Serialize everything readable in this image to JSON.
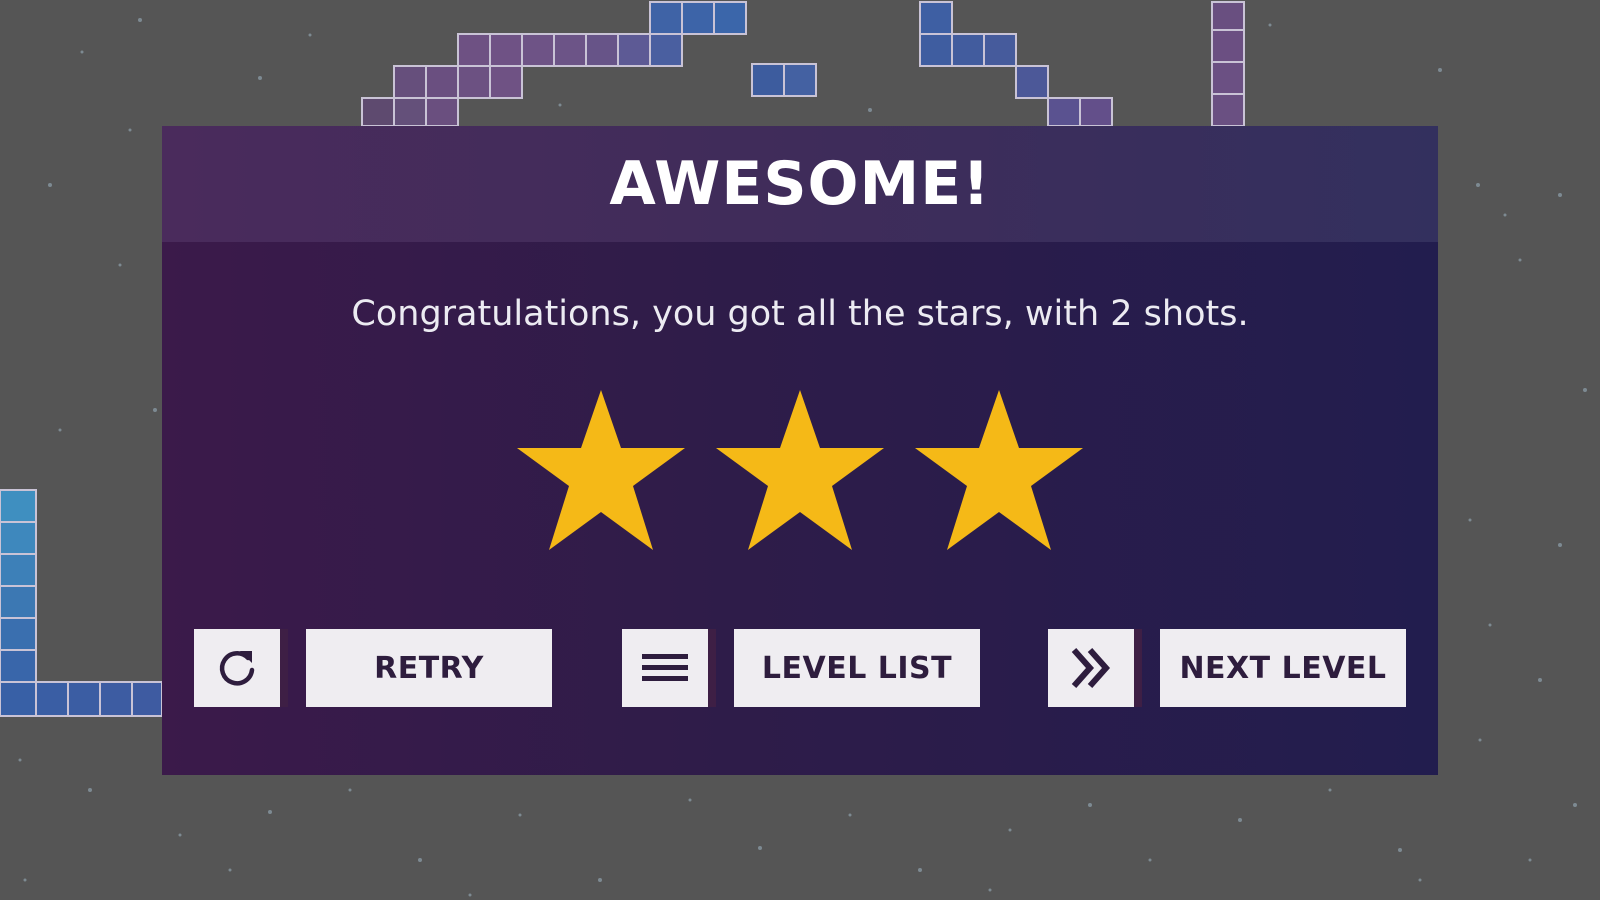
{
  "modal": {
    "title": "AWESOME!",
    "message": "Congratulations, you got all the stars, with 2 shots.",
    "stars_earned": 3,
    "stars_total": 3,
    "star_color": "#f5b917"
  },
  "buttons": {
    "retry": {
      "label": "RETRY",
      "icon": "retry-icon"
    },
    "level_list": {
      "label": "LEVEL LIST",
      "icon": "menu-icon"
    },
    "next_level": {
      "label": "NEXT LEVEL",
      "icon": "double-chevron-right-icon"
    }
  },
  "colors": {
    "background": "#555555",
    "button_bg": "#efedf1",
    "button_text": "#2e1d3e",
    "tile_purple": "#6d4f8a",
    "tile_blue": "#2f61a8"
  }
}
